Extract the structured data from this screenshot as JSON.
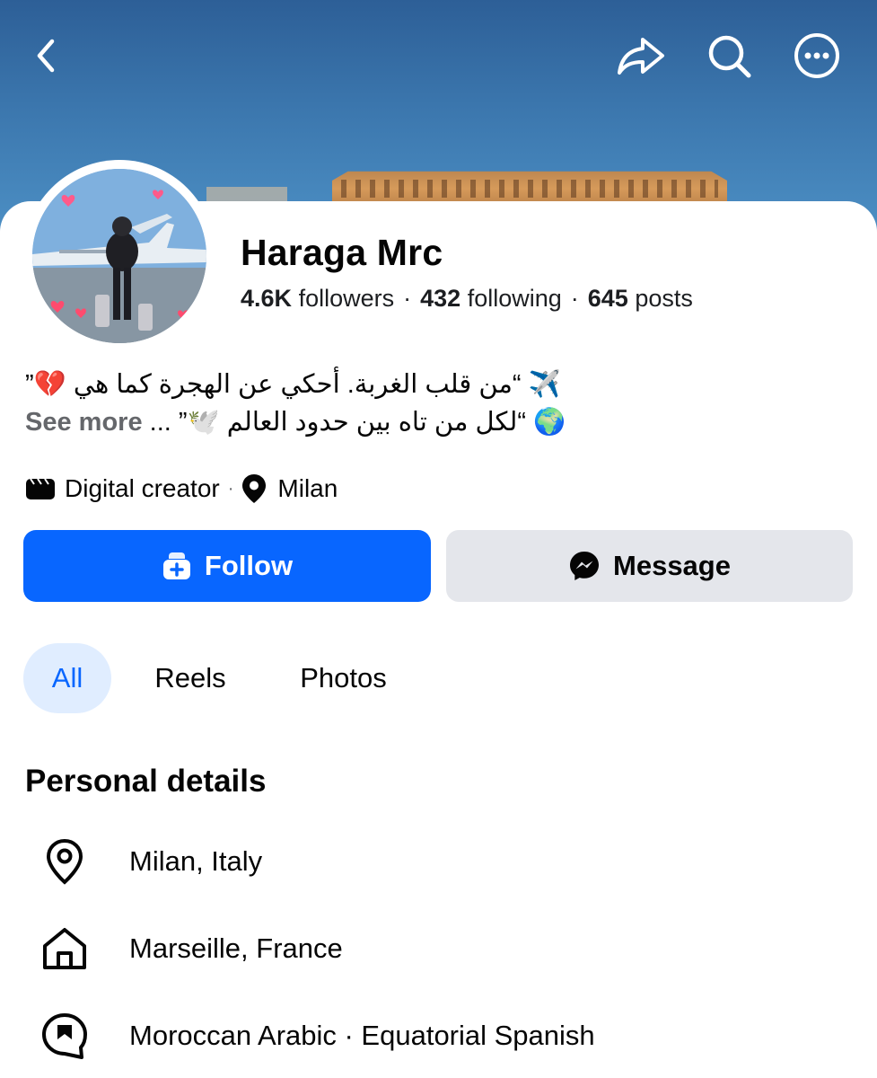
{
  "header": {
    "back_icon": "chevron-left-icon",
    "share_icon": "share-arrow-icon",
    "search_icon": "search-icon",
    "more_icon": "more-options-icon"
  },
  "profile": {
    "name": "Haraga Mrc",
    "followers_count": "4.6K",
    "followers_label": "followers",
    "following_count": "432",
    "following_label": "following",
    "posts_count": "645",
    "posts_label": "posts",
    "stats_separator": "·"
  },
  "bio": {
    "line1": "“من قلب الغربة. أحكي عن الهجرة كما هي 💔”",
    "line1_emoji": "✈️",
    "line2": "“لكل من تاه بين حدود العالم 🕊️”",
    "line2_emoji": "🌍",
    "ellipsis": "...",
    "see_more": "See more"
  },
  "meta": {
    "category": "Digital creator",
    "separator": "·",
    "location": "Milan"
  },
  "actions": {
    "follow_label": "Follow",
    "message_label": "Message",
    "follow_color": "#0866ff"
  },
  "tabs": [
    {
      "label": "All",
      "selected": true
    },
    {
      "label": "Reels",
      "selected": false
    },
    {
      "label": "Photos",
      "selected": false
    }
  ],
  "personal_details": {
    "title": "Personal details",
    "items": [
      {
        "icon": "location-pin-icon",
        "text": "Milan, Italy"
      },
      {
        "icon": "home-icon",
        "text": "Marseille, France"
      },
      {
        "icon": "language-chat-icon",
        "text": "Moroccan Arabic · Equatorial Spanish"
      }
    ]
  }
}
